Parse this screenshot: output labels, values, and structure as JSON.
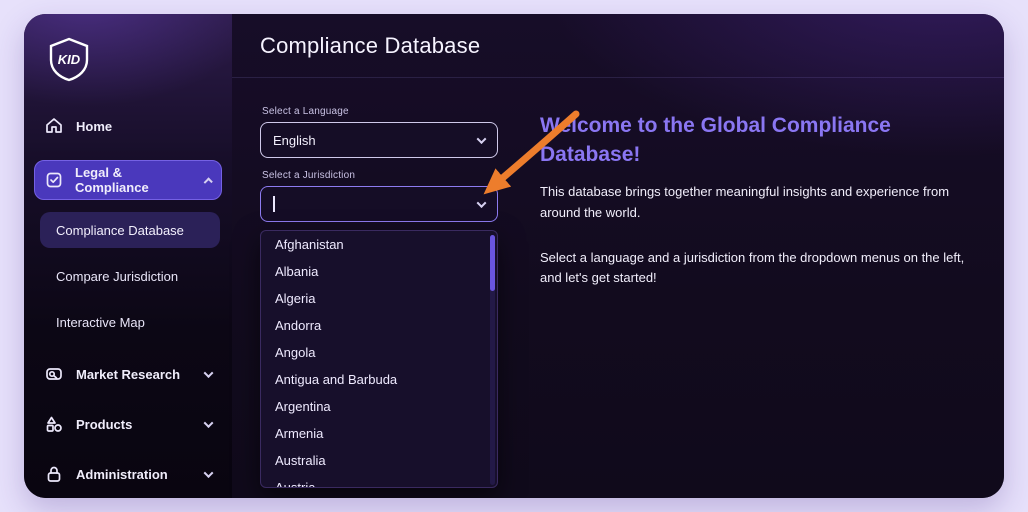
{
  "sidebar": {
    "logo": "KID",
    "items": [
      {
        "label": "Home"
      },
      {
        "label": "Legal & Compliance"
      },
      {
        "label": "Compliance Database"
      },
      {
        "label": "Compare Jurisdiction"
      },
      {
        "label": "Interactive Map"
      },
      {
        "label": "Market Research"
      },
      {
        "label": "Products"
      },
      {
        "label": "Administration"
      }
    ]
  },
  "header": {
    "title": "Compliance Database"
  },
  "form": {
    "language_label": "Select a Language",
    "language_value": "English",
    "jurisdiction_label": "Select a Jurisdiction",
    "jurisdiction_value": "",
    "options": [
      "Afghanistan",
      "Albania",
      "Algeria",
      "Andorra",
      "Angola",
      "Antigua and Barbuda",
      "Argentina",
      "Armenia",
      "Australia",
      "Austria"
    ]
  },
  "welcome": {
    "heading": "Welcome to the Global Compliance Database!",
    "paragraph1": "This database brings together meaningful insights and experience from around the world.",
    "paragraph2": "Select a language and a jurisdiction from the dropdown menus on the left, and let's get started!"
  },
  "colors": {
    "accent_purple": "#8a76f2",
    "active_item": "#4a38bc",
    "arrow_orange": "#ed7d2c",
    "page_background": "#e7e1fb"
  }
}
